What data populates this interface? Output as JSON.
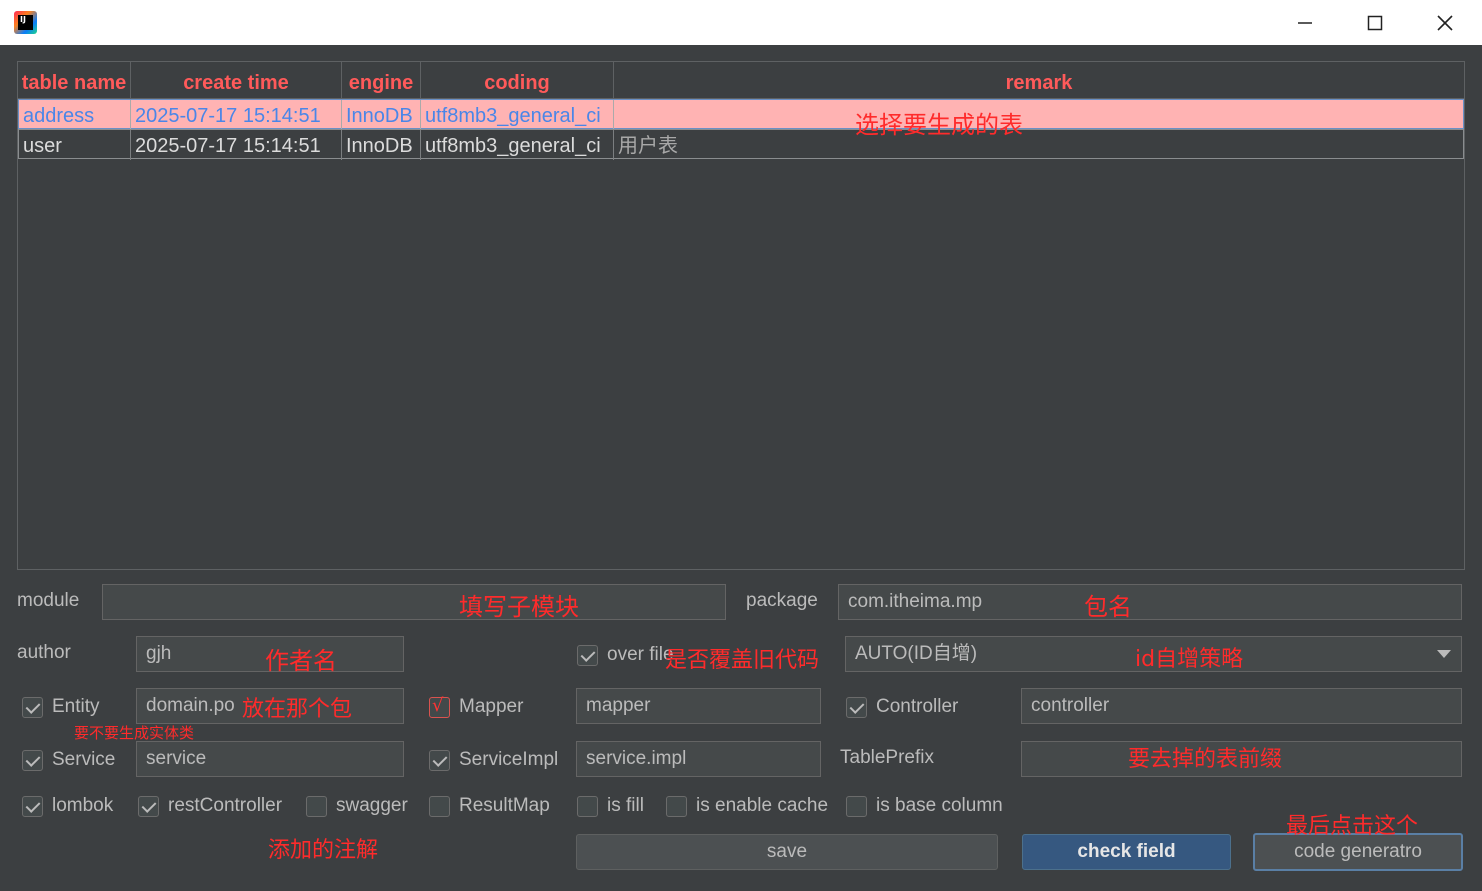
{
  "titlebar": {
    "icon": "intellij-idea-icon",
    "app_icon_text": "IJ",
    "minimize": "—",
    "maximize": "☐",
    "close": "✕"
  },
  "table": {
    "headers": [
      "table name",
      "create time",
      "engine",
      "coding",
      "remark"
    ],
    "rows": [
      [
        "address",
        "2025-07-17 15:14:51",
        "InnoDB",
        "utf8mb3_general_ci",
        ""
      ],
      [
        "user",
        "2025-07-17 15:14:51",
        "InnoDB",
        "utf8mb3_general_ci",
        "用户表"
      ]
    ]
  },
  "form": {
    "module_label": "module",
    "module_value": "",
    "package_label": "package",
    "package_value": "com.itheima.mp",
    "author_label": "author",
    "author_value": "gjh",
    "over_file_label": "over file",
    "over_file_checked": true,
    "id_strategy_value": "AUTO(ID自增)",
    "entity_label": "Entity",
    "entity_value": "domain.po",
    "mapper_label": "Mapper",
    "mapper_value": "mapper",
    "controller_label": "Controller",
    "controller_value": "controller",
    "service_label": "Service",
    "service_value": "service",
    "service_impl_label": "ServiceImpl",
    "service_impl_value": "service.impl",
    "table_prefix_label": "TablePrefix",
    "table_prefix_value": "",
    "lombok_label": "lombok",
    "rest_controller_label": "restController",
    "swagger_label": "swagger",
    "result_map_label": "ResultMap",
    "is_fill_label": "is fill",
    "is_enable_cache_label": "is enable cache",
    "is_base_column_label": "is base column"
  },
  "buttons": {
    "save": "save",
    "check_field": "check field",
    "code_generator": "code generatro"
  },
  "annotations": {
    "select_table": "选择要生成的表",
    "module": "填写子模块",
    "package": "包名",
    "author": "作者名",
    "override": "是否覆盖旧代码",
    "id_strategy": "id自增策略",
    "entity_package": "放在那个包",
    "entity_generate": "要不要生成实体类",
    "mapper_check": "√",
    "table_prefix": "要去掉的表前缀",
    "annotations_added": "添加的注解",
    "click_last": "最后点击这个"
  },
  "colors": {
    "background": "#3c3f41",
    "header_text": "#ff5a5a",
    "selected_row": "#ffb3b3",
    "selected_text": "#4a86e8",
    "annotation": "#ff2b2b",
    "primary_button": "#365880"
  }
}
